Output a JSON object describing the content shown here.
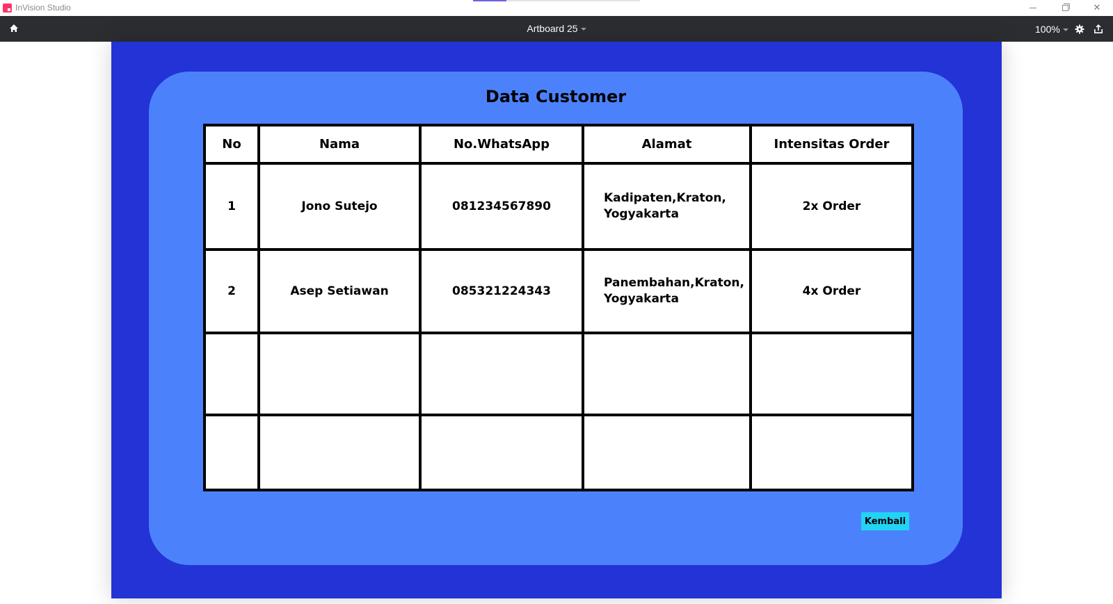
{
  "window": {
    "app_title": "InVision Studio",
    "minimize_glyph": "",
    "close_glyph": "✕"
  },
  "toolbar": {
    "artboard_title": "Artboard 25",
    "zoom": "100%",
    "icons": [
      "home-icon",
      "gear-icon",
      "share-icon"
    ]
  },
  "artboard": {
    "title": "Data Customer",
    "table": {
      "headers": [
        "No",
        "Nama",
        "No.WhatsApp",
        "Alamat",
        "Intensitas Order"
      ],
      "rows": [
        {
          "no": "1",
          "nama": "Jono Sutejo",
          "whatsapp": "081234567890",
          "alamat_line1": "Kadipaten,Kraton,",
          "alamat_line2": "Yogyakarta",
          "order": "2x Order"
        },
        {
          "no": "2",
          "nama": "Asep Setiawan",
          "whatsapp": "085321224343",
          "alamat_line1": "Panembahan,Kraton,",
          "alamat_line2": "Yogyakarta",
          "order": "4x Order"
        },
        {
          "no": "",
          "nama": "",
          "whatsapp": "",
          "alamat_line1": "",
          "alamat_line2": "",
          "order": ""
        },
        {
          "no": "",
          "nama": "",
          "whatsapp": "",
          "alamat_line1": "",
          "alamat_line2": "",
          "order": ""
        }
      ]
    },
    "back_button": "Kembali"
  },
  "colors": {
    "artboard_bg": "#2433d6",
    "panel_bg": "#4b82fc",
    "button_bg": "#22d3f4",
    "toolbar_bg": "#2b2d31"
  }
}
